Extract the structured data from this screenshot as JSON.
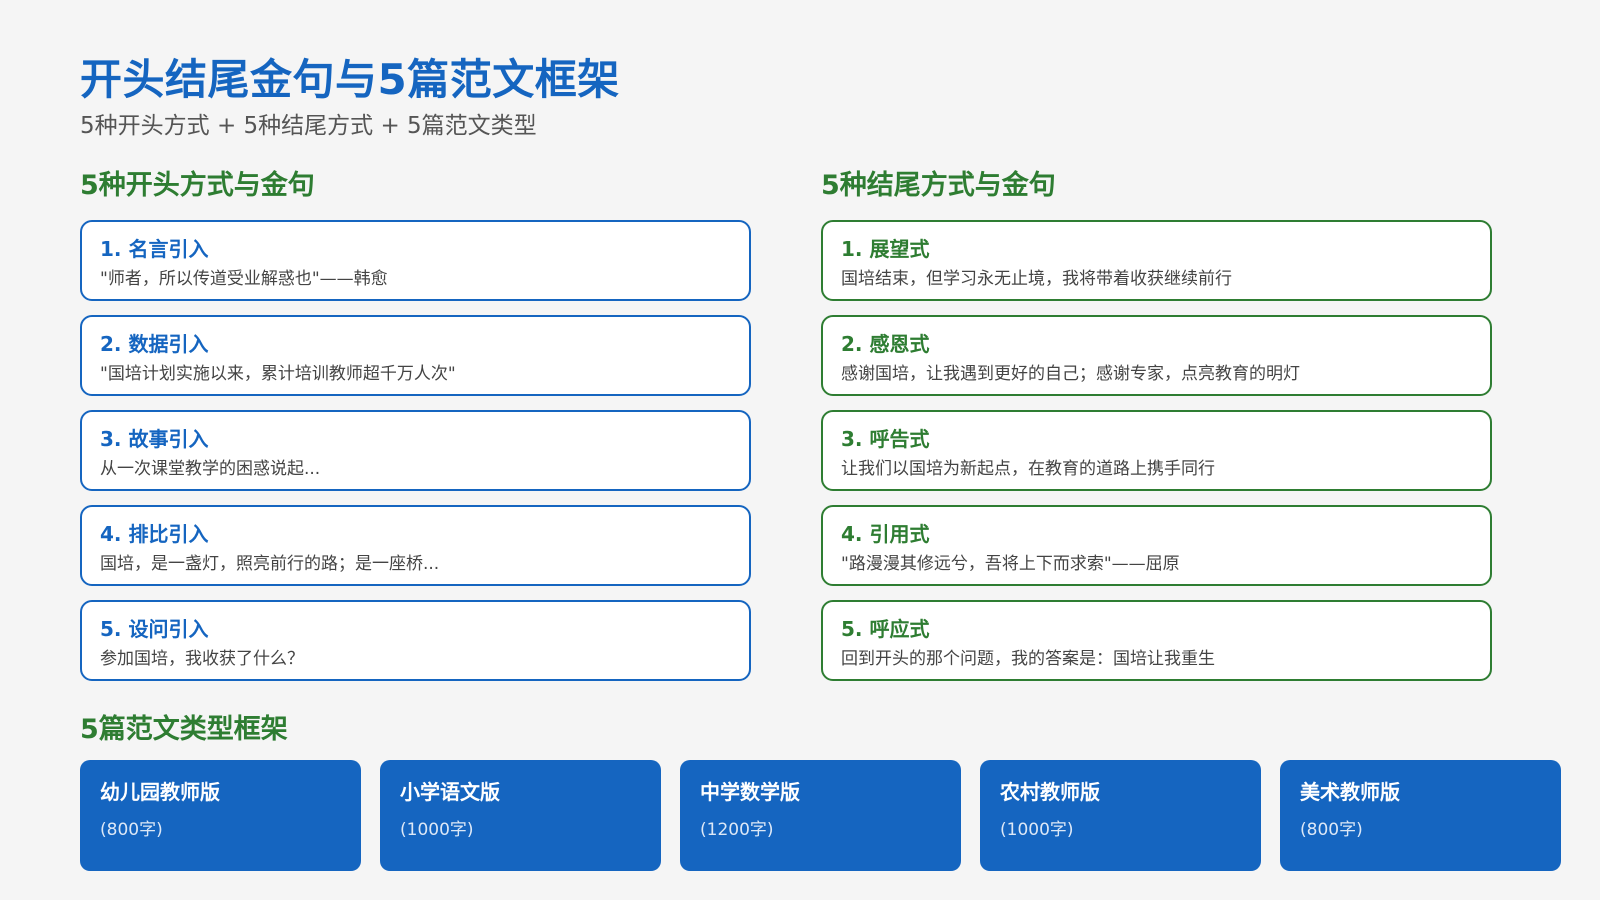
{
  "header": {
    "title": "开头结尾金句与5篇范文框架",
    "subtitle": "5种开头方式 + 5种结尾方式 + 5篇范文类型"
  },
  "openings": {
    "heading": "5种开头方式与金句",
    "items": [
      {
        "title": "1. 名言引入",
        "desc": "\"师者，所以传道受业解惑也\"——韩愈"
      },
      {
        "title": "2. 数据引入",
        "desc": "\"国培计划实施以来，累计培训教师超千万人次\""
      },
      {
        "title": "3. 故事引入",
        "desc": "从一次课堂教学的困惑说起..."
      },
      {
        "title": "4. 排比引入",
        "desc": "国培，是一盏灯，照亮前行的路；是一座桥..."
      },
      {
        "title": "5. 设问引入",
        "desc": "参加国培，我收获了什么？"
      }
    ]
  },
  "endings": {
    "heading": "5种结尾方式与金句",
    "items": [
      {
        "title": "1. 展望式",
        "desc": "国培结束，但学习永无止境，我将带着收获继续前行"
      },
      {
        "title": "2. 感恩式",
        "desc": "感谢国培，让我遇到更好的自己；感谢专家，点亮教育的明灯"
      },
      {
        "title": "3. 呼告式",
        "desc": "让我们以国培为新起点，在教育的道路上携手同行"
      },
      {
        "title": "4. 引用式",
        "desc": "\"路漫漫其修远兮，吾将上下而求索\"——屈原"
      },
      {
        "title": "5. 呼应式",
        "desc": "回到开头的那个问题，我的答案是：国培让我重生"
      }
    ]
  },
  "essays": {
    "heading": "5篇范文类型框架",
    "items": [
      {
        "name": "幼儿园教师版",
        "count": "(800字)"
      },
      {
        "name": "小学语文版",
        "count": "(1000字)"
      },
      {
        "name": "中学数学版",
        "count": "(1200字)"
      },
      {
        "name": "农村教师版",
        "count": "(1000字)"
      },
      {
        "name": "美术教师版",
        "count": "(800字)"
      }
    ]
  },
  "colors": {
    "primary_blue": "#1565c0",
    "primary_green": "#2e7d32",
    "background": "#f5f5f5"
  }
}
